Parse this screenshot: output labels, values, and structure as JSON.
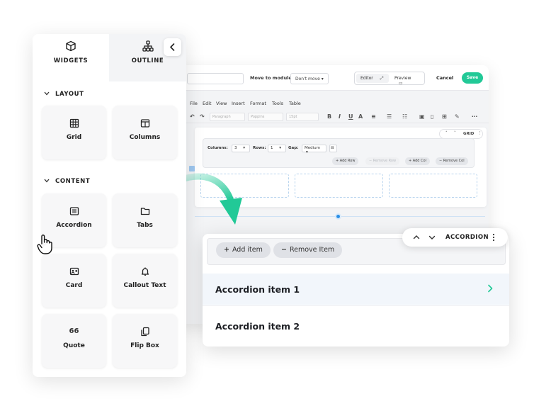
{
  "editor": {
    "move_label": "Move to module:",
    "move_value": "Don't move",
    "editor_tab": "Editor",
    "preview_tab": "Preview",
    "cancel": "Cancel",
    "save": "Save",
    "menu": [
      "File",
      "Edit",
      "View",
      "Insert",
      "Format",
      "Tools",
      "Table"
    ],
    "format_selects": [
      "Paragraph",
      "Poppins",
      "15pt"
    ],
    "grid_toolbar": {
      "columns_label": "Columns:",
      "columns_value": "3",
      "rows_label": "Rows:",
      "rows_value": "1",
      "gap_label": "Gap:",
      "gap_value": "Medium",
      "buttons": [
        "+ Add Row",
        "− Remove Row",
        "+ Add Col",
        "− Remove Col"
      ]
    },
    "mini_toolbar_label": "GRID"
  },
  "panel": {
    "tabs": [
      {
        "label": "WIDGETS",
        "icon": "cube-icon"
      },
      {
        "label": "OUTLINE",
        "icon": "sitemap-icon"
      }
    ],
    "sections": [
      {
        "title": "LAYOUT",
        "items": [
          {
            "label": "Grid",
            "icon": "grid-icon"
          },
          {
            "label": "Columns",
            "icon": "columns-icon"
          }
        ]
      },
      {
        "title": "CONTENT",
        "items": [
          {
            "label": "Accordion",
            "icon": "accordion-icon"
          },
          {
            "label": "Tabs",
            "icon": "folder-icon"
          },
          {
            "label": "Card",
            "icon": "card-icon"
          },
          {
            "label": "Callout Text",
            "icon": "bell-icon"
          },
          {
            "label": "Quote",
            "icon": "quote-icon",
            "glyph": "66"
          },
          {
            "label": "Flip Box",
            "icon": "copy-icon"
          }
        ]
      }
    ]
  },
  "accordion": {
    "add_item": "Add item",
    "remove_item": "Remove Item",
    "items": [
      "Accordion item 1",
      "Accordion item 2"
    ],
    "toolbar_label": "ACCORDION"
  },
  "colors": {
    "accent": "#22c997",
    "blue": "#2b8fe6"
  }
}
